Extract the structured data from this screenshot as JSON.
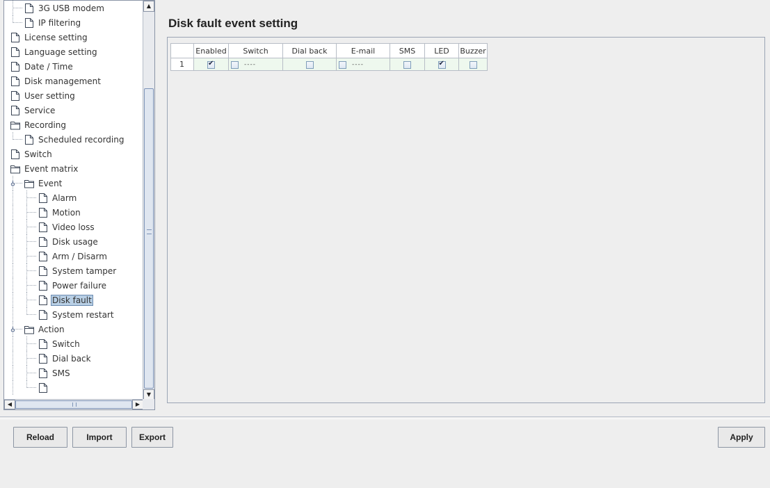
{
  "tree": {
    "items": [
      {
        "label": "3G USB modem",
        "icon": "page-icon",
        "depth": 1
      },
      {
        "label": "IP filtering",
        "icon": "page-icon",
        "depth": 1
      },
      {
        "label": "License setting",
        "icon": "page-icon",
        "depth": 0
      },
      {
        "label": "Language setting",
        "icon": "page-icon",
        "depth": 0
      },
      {
        "label": "Date / Time",
        "icon": "page-icon",
        "depth": 0
      },
      {
        "label": "Disk management",
        "icon": "page-icon",
        "depth": 0
      },
      {
        "label": "User setting",
        "icon": "page-icon",
        "depth": 0
      },
      {
        "label": "Service",
        "icon": "page-icon",
        "depth": 0
      },
      {
        "label": "Recording",
        "icon": "folder-icon",
        "depth": 0
      },
      {
        "label": "Scheduled recording",
        "icon": "page-icon",
        "depth": 1
      },
      {
        "label": "Switch",
        "icon": "page-icon",
        "depth": 0
      },
      {
        "label": "Event matrix",
        "icon": "folder-icon",
        "depth": 0
      },
      {
        "label": "Event",
        "icon": "folder-icon",
        "depth": 1,
        "expanded": true
      },
      {
        "label": "Alarm",
        "icon": "page-icon",
        "depth": 2
      },
      {
        "label": "Motion",
        "icon": "page-icon",
        "depth": 2
      },
      {
        "label": "Video loss",
        "icon": "page-icon",
        "depth": 2
      },
      {
        "label": "Disk usage",
        "icon": "page-icon",
        "depth": 2
      },
      {
        "label": "Arm / Disarm",
        "icon": "page-icon",
        "depth": 2
      },
      {
        "label": "System tamper",
        "icon": "page-icon",
        "depth": 2
      },
      {
        "label": "Power failure",
        "icon": "page-icon",
        "depth": 2
      },
      {
        "label": "Disk fault",
        "icon": "page-icon",
        "depth": 2,
        "selected": true
      },
      {
        "label": "System restart",
        "icon": "page-icon",
        "depth": 2
      },
      {
        "label": "Action",
        "icon": "folder-icon",
        "depth": 1,
        "expanded": true
      },
      {
        "label": "Switch",
        "icon": "page-icon",
        "depth": 2
      },
      {
        "label": "Dial back",
        "icon": "page-icon",
        "depth": 2
      },
      {
        "label": "SMS",
        "icon": "page-icon",
        "depth": 2
      },
      {
        "label": "",
        "icon": "page-icon",
        "depth": 2
      }
    ]
  },
  "main": {
    "title": "Disk fault event setting",
    "table": {
      "columns": [
        "",
        "Enabled",
        "Switch",
        "Dial back",
        "E-mail",
        "SMS",
        "LED",
        "Buzzer"
      ],
      "rows": [
        {
          "num": "1",
          "enabled": true,
          "switch": {
            "checked": false,
            "text": "----"
          },
          "dial_back": false,
          "email": {
            "checked": false,
            "text": "----"
          },
          "sms": false,
          "led": true,
          "buzzer": false
        }
      ]
    }
  },
  "buttons": {
    "reload": "Reload",
    "import": "Import",
    "export": "Export",
    "apply": "Apply"
  }
}
